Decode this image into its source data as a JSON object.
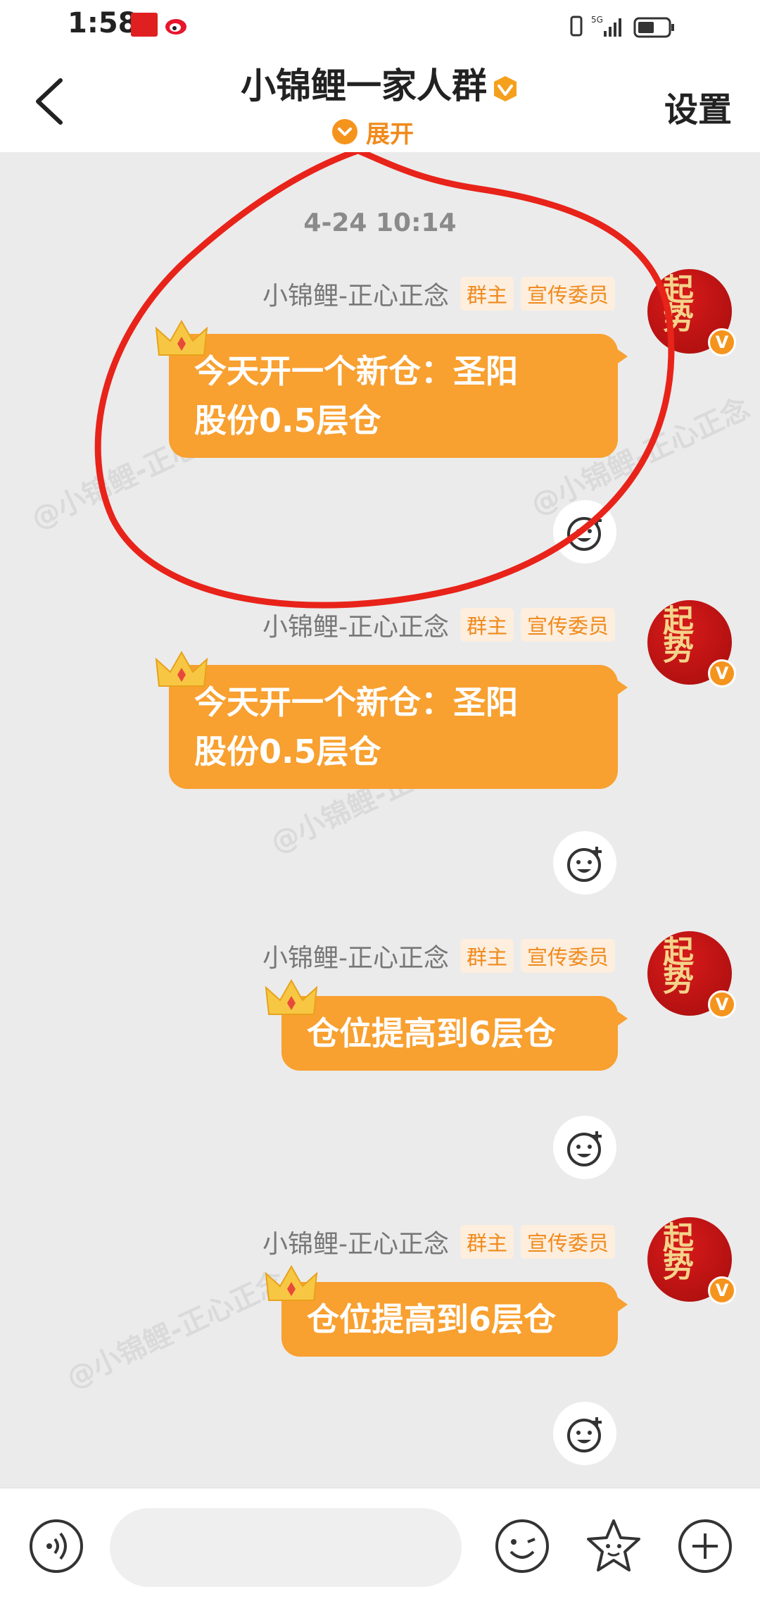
{
  "status_bar": {
    "time": "1:58",
    "network": "5G"
  },
  "header": {
    "title": "小锦鲤一家人群",
    "expand_label": "展开",
    "settings_label": "设置"
  },
  "chat": {
    "timestamp": "4-24 10:14",
    "watermark": "@小锦鲤-正心正念",
    "messages": [
      {
        "sender": "小锦鲤-正心正念",
        "tag1": "群主",
        "tag2": "宣传委员",
        "line1": "今天开一个新仓：圣阳",
        "line2": "股份0.5层仓",
        "avatar_text": "起势"
      },
      {
        "sender": "小锦鲤-正心正念",
        "tag1": "群主",
        "tag2": "宣传委员",
        "line1": "今天开一个新仓：圣阳",
        "line2": "股份0.5层仓",
        "avatar_text": "起势"
      },
      {
        "sender": "小锦鲤-正心正念",
        "tag1": "群主",
        "tag2": "宣传委员",
        "line1": "仓位提高到6层仓",
        "line2": "",
        "avatar_text": "起势"
      },
      {
        "sender": "小锦鲤-正心正念",
        "tag1": "群主",
        "tag2": "宣传委员",
        "line1": "仓位提高到6层仓",
        "line2": "",
        "avatar_text": "起势"
      }
    ]
  },
  "colors": {
    "bubble": "#f8a030",
    "accent": "#f08a1c",
    "annotation": "#e8231a"
  }
}
